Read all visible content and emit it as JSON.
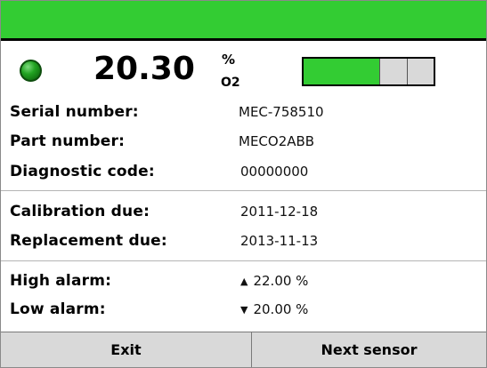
{
  "reading": {
    "value": "20.30",
    "unit": "%",
    "gas": "O2",
    "bar_level_percent": 58
  },
  "details": {
    "serial_number": {
      "label": "Serial number:",
      "value": "MEC-758510"
    },
    "part_number": {
      "label": "Part number:",
      "value": "MECO2ABB"
    },
    "diagnostic_code": {
      "label": "Diagnostic code:",
      "value": "00000000"
    },
    "calibration_due": {
      "label": "Calibration due:",
      "value": "2011-12-18"
    },
    "replacement_due": {
      "label": "Replacement due:",
      "value": "2013-11-13"
    },
    "high_alarm": {
      "label": "High alarm:",
      "value": "22.00 %",
      "arrow": "▲"
    },
    "low_alarm": {
      "label": "Low alarm:",
      "value": "20.00 %",
      "arrow": "▼"
    }
  },
  "buttons": {
    "exit": "Exit",
    "next_sensor": "Next sensor"
  },
  "colors": {
    "title_bar": "#33cc33",
    "status_led": "#22a322",
    "bar_fill": "#33cc33"
  }
}
